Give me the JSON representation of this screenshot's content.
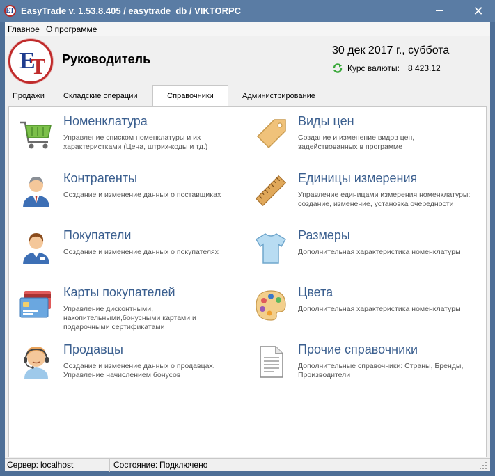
{
  "window": {
    "title": "EasyTrade v. 1.53.8.405 / easytrade_db / VIKTORPC",
    "close_symbol": "✕"
  },
  "menu": {
    "items": [
      "Главное",
      "О программе"
    ]
  },
  "header": {
    "logo_text": [
      "E",
      "T"
    ],
    "user": "Руководитель",
    "date": "30 дек 2017 г., суббота",
    "rate_label": "Курс валюты:",
    "rate_value": "8 423.12"
  },
  "tabs": {
    "items": [
      "Продажи",
      "Складские операции",
      "Справочники",
      "Администрирование"
    ],
    "active": "Справочники"
  },
  "cards": [
    {
      "title": "Номенклатура",
      "desc": "Управление списком номенклатуры и их характеристками (Цена, штрих-коды и тд.)",
      "icon": "shopping-cart-icon"
    },
    {
      "title": "Виды цен",
      "desc": "Создание и изменение видов цен, задействованных в программе",
      "icon": "price-tag-icon"
    },
    {
      "title": "Контрагенты",
      "desc": "Создание и изменение данных о поставщиках",
      "icon": "businessman-icon"
    },
    {
      "title": "Единицы измерения",
      "desc": "Управление единицами измерения номенклатуры: создание, изменение, установка очередности",
      "icon": "ruler-icon"
    },
    {
      "title": "Покупатели",
      "desc": "Создание и изменение данных о покупателях",
      "icon": "customer-icon"
    },
    {
      "title": "Размеры",
      "desc": "Дополнительная характеристика номенклатуры",
      "icon": "tshirt-icon"
    },
    {
      "title": "Карты покупателей",
      "desc": "Управление дисконтными, накопительными,бонусными картами и подарочными сертификатами",
      "icon": "cards-icon"
    },
    {
      "title": "Цвета",
      "desc": "Дополнительная характеристика номенклатуры",
      "icon": "palette-icon"
    },
    {
      "title": "Продавцы",
      "desc": "Создание и изменение данных о продавцах. Управление начислением бонусов",
      "icon": "seller-headset-icon"
    },
    {
      "title": "Прочие справочники",
      "desc": "Дополнительные справочники: Страны, Бренды, Производители",
      "icon": "document-icon"
    }
  ],
  "status": {
    "server_label": "Сервер:",
    "server_value": "localhost",
    "state_label": "Состояние:",
    "state_value": "Подключено"
  },
  "colors": {
    "titlebar": "#5a7ca4",
    "card_title": "#3b5f8f",
    "logo_red": "#c02b2b",
    "logo_blue": "#1e3c8e"
  }
}
